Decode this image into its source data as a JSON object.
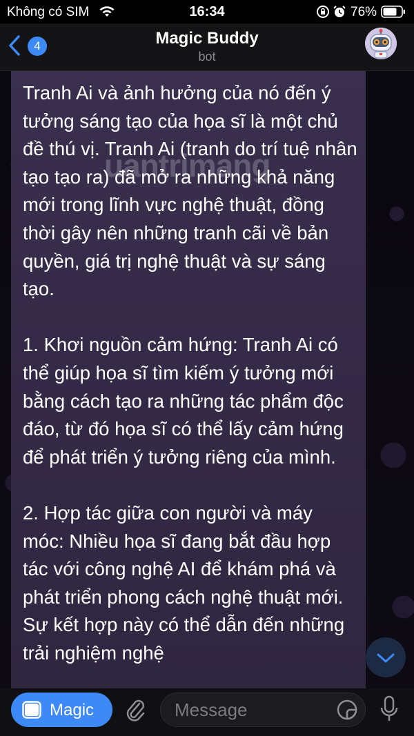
{
  "status_bar": {
    "carrier": "Không có SIM",
    "time": "16:34",
    "battery_percent": "76%",
    "battery_level": 0.76
  },
  "header": {
    "back_badge": "4",
    "title": "Magic Buddy",
    "subtitle": "bot"
  },
  "message": {
    "text": "Tranh Ai và ảnh hưởng của nó đến ý tưởng sáng tạo của họa sĩ là một chủ đề thú vị. Tranh Ai (tranh do trí tuệ nhân tạo tạo ra) đã mở ra những khả năng mới trong lĩnh vực nghệ thuật, đồng thời gây nên những tranh cãi về bản quyền, giá trị nghệ thuật và sự sáng tạo.\n\n1. Khơi nguồn cảm hứng: Tranh Ai có thể giúp họa sĩ tìm kiếm ý tưởng mới bằng cách tạo ra những tác phẩm độc đáo, từ đó họa sĩ có thể lấy cảm hứng để phát triển ý tưởng riêng của mình.\n\n2. Hợp tác giữa con người và máy móc: Nhiều họa sĩ đang bắt đầu hợp tác với công nghệ AI để khám phá và phát triển phong cách nghệ thuật mới. Sự kết hợp này có thể dẫn đến những trải nghiệm nghệ",
    "watermark": "uantrimang"
  },
  "input_bar": {
    "magic_label": "Magic",
    "placeholder": "Message"
  },
  "colors": {
    "accent": "#3d8af7",
    "bubble": "#3a2f4e",
    "header_bg": "#141416"
  },
  "icons": [
    "wifi-icon",
    "lock-rotation-icon",
    "alarm-icon",
    "battery-icon",
    "back-chevron-icon",
    "robot-avatar",
    "chevron-down-icon",
    "magic-menu-icon",
    "paperclip-icon",
    "sticker-icon",
    "microphone-icon"
  ]
}
